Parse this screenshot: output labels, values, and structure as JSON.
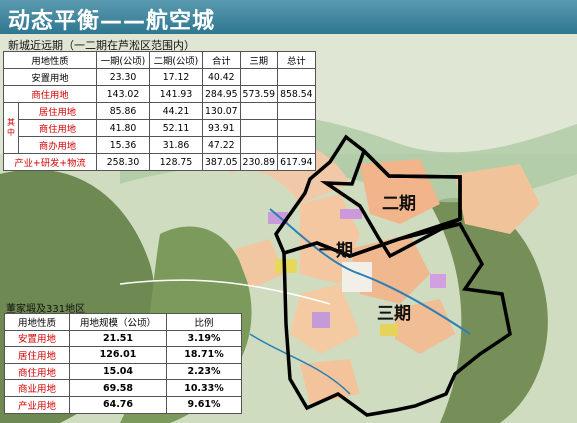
{
  "header": {
    "title": "动态平衡——航空城"
  },
  "table1": {
    "caption": "新城近远期（一二期在芦淞区范围内）",
    "columns": [
      "用地性质",
      "一期(公顷)",
      "二期(公顷)",
      "合计",
      "三期",
      "总计"
    ],
    "group_label": "其中",
    "rows": [
      {
        "name": "安置用地",
        "p1": "23.30",
        "p2": "17.12",
        "sum": "40.42",
        "p3": "",
        "total": ""
      },
      {
        "name": "商住用地",
        "p1": "143.02",
        "p2": "141.93",
        "sum": "284.95",
        "p3": "573.59",
        "total": "858.54"
      },
      {
        "name": "居住用地",
        "p1": "85.86",
        "p2": "44.21",
        "sum": "130.07",
        "p3": "",
        "total": ""
      },
      {
        "name": "商住用地",
        "p1": "41.80",
        "p2": "52.11",
        "sum": "93.91",
        "p3": "",
        "total": ""
      },
      {
        "name": "商办用地",
        "p1": "15.36",
        "p2": "31.86",
        "sum": "47.22",
        "p3": "",
        "total": ""
      },
      {
        "name": "产业+研发+物流",
        "p1": "258.30",
        "p2": "128.75",
        "sum": "387.05",
        "p3": "230.89",
        "total": "617.94"
      }
    ]
  },
  "table2": {
    "caption": "董家塅及331地区",
    "columns": [
      "用地性质",
      "用地规模（公顷）",
      "比例"
    ],
    "rows": [
      {
        "name": "安置用地",
        "area": "21.51",
        "ratio": "3.19%"
      },
      {
        "name": "居住用地",
        "area": "126.01",
        "ratio": "18.71%"
      },
      {
        "name": "商住用地",
        "area": "15.04",
        "ratio": "2.23%"
      },
      {
        "name": "商业用地",
        "area": "69.58",
        "ratio": "10.33%"
      },
      {
        "name": "产业用地",
        "area": "64.76",
        "ratio": "9.61%"
      }
    ]
  },
  "map": {
    "phase_labels": [
      "一期",
      "二期",
      "三期"
    ],
    "colors": {
      "title_bar": "#2f7690",
      "highlight_text": "#d10000",
      "boundary": "#000000"
    }
  }
}
